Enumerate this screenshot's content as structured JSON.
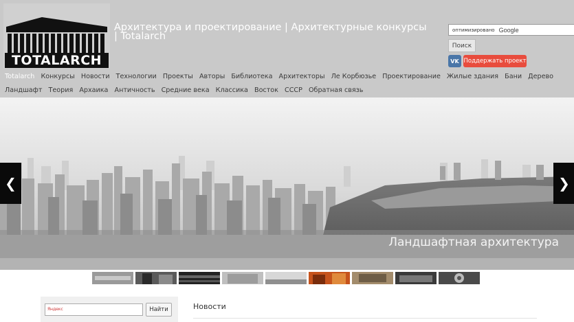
{
  "site": {
    "logo_text": "TOTALARCH",
    "title": "Архитектура и проектирование | Архитектурные конкурсы | Totalarch"
  },
  "search": {
    "powered_by": "оптимизировано",
    "provider": "Google",
    "button_label": "Поиск"
  },
  "social": {
    "vk_label": "VK",
    "support_label": "Поддержать проект"
  },
  "nav_row1": [
    "Totalarch",
    "Конкурсы",
    "Новости",
    "Технологии",
    "Проекты",
    "Авторы",
    "Библиотека",
    "Архитекторы",
    "Ле Корбюзье",
    "Проектирование",
    "Жилые здания",
    "Бани",
    "Дерево"
  ],
  "nav_row2": [
    "Ландшафт",
    "Теория",
    "Архаика",
    "Античность",
    "Средние века",
    "Классика",
    "Восток",
    "СССР",
    "Обратная связь"
  ],
  "slider": {
    "caption": "Ландшафтная архитектура",
    "prev_icon": "chevron-left-icon",
    "next_icon": "chevron-right-icon",
    "thumbnail_count": 9
  },
  "sidebar": {
    "search_placeholder": "Яндекс",
    "search_button": "Найти"
  },
  "main": {
    "section_title": "Новости"
  },
  "colors": {
    "header_bg": "#c9c9c9",
    "support_button": "#e84c3d",
    "vk": "#4a76a8",
    "arrow_bg": "#0a0a0a"
  }
}
